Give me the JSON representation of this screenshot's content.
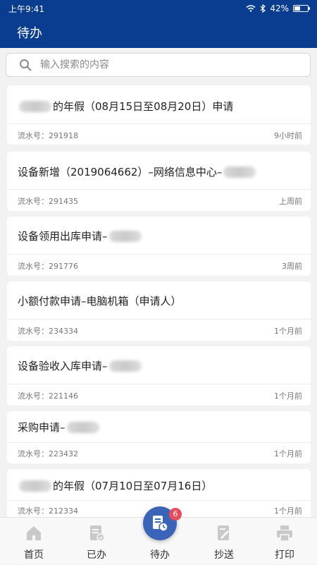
{
  "status_bar": {
    "time": "上午9:41",
    "battery": "42%",
    "battery_level": 0.42
  },
  "header": {
    "title": "待办"
  },
  "search": {
    "placeholder": "输入搜索的内容"
  },
  "items": [
    {
      "title_prefix": "",
      "title_suffix": "的年假（08月15日至08月20日）申请",
      "serial_label": "流水号：",
      "serial": "291918",
      "time": "9小时前"
    },
    {
      "title_prefix": "设备新增（2019064662）–网络信息中心–",
      "title_suffix": "",
      "serial_label": "流水号：",
      "serial": "291435",
      "time": "上周前"
    },
    {
      "title_prefix": "设备领用出库申请–",
      "title_suffix": "",
      "serial_label": "流水号：",
      "serial": "291776",
      "time": "3周前"
    },
    {
      "title_prefix": "小额付款申请–电脑机箱（申请人）",
      "title_suffix": "",
      "serial_label": "流水号：",
      "serial": "234334",
      "time": "1个月前"
    },
    {
      "title_prefix": "设备验收入库申请–",
      "title_suffix": "",
      "serial_label": "流水号：",
      "serial": "221146",
      "time": "1个月前"
    },
    {
      "title_prefix": "采购申请–",
      "title_suffix": "",
      "serial_label": "流水号：",
      "serial": "223432",
      "time": "1个月前"
    },
    {
      "title_prefix": "",
      "title_suffix": "的年假（07月10日至07月16日）",
      "serial_label": "流水号：",
      "serial": "212334",
      "time": "1个月前"
    }
  ],
  "tabs": [
    {
      "label": "首页",
      "icon": "home-icon"
    },
    {
      "label": "已办",
      "icon": "done-icon"
    },
    {
      "label": "待办",
      "icon": "todo-icon"
    },
    {
      "label": "抄送",
      "icon": "cc-icon"
    },
    {
      "label": "打印",
      "icon": "print-icon"
    }
  ],
  "badge_count": "6",
  "colors": {
    "primary": "#0a3d8f",
    "accent": "#3b63b7",
    "badge": "#e74c5c"
  }
}
